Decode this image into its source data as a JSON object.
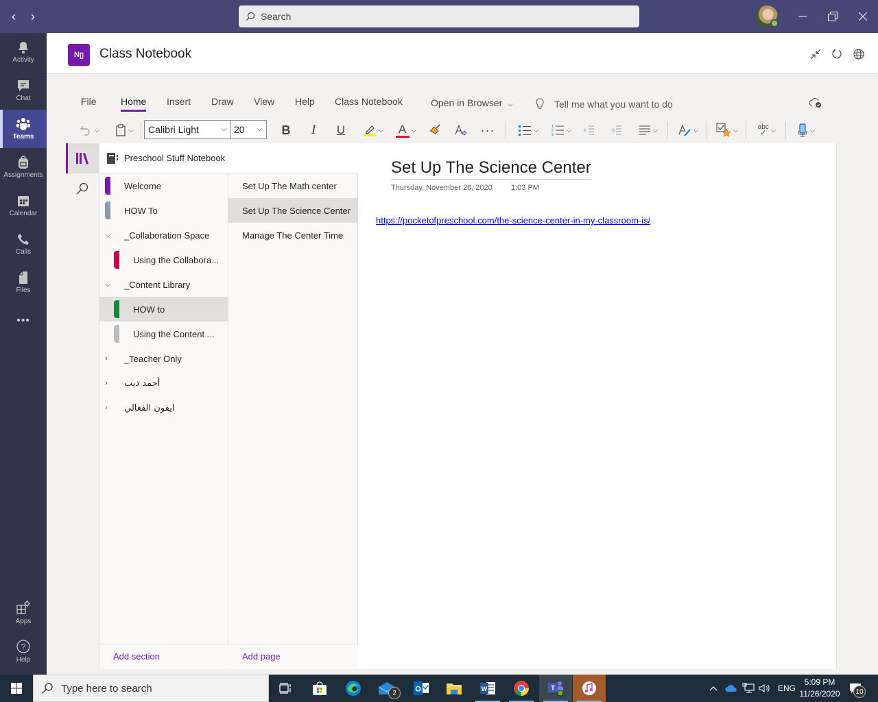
{
  "titlebar": {
    "back_label": "‹",
    "forward_label": "›",
    "search_placeholder": "Search",
    "minimize": "—",
    "restore": "❐",
    "close": "✕"
  },
  "rail": {
    "items": [
      {
        "label": "Activity",
        "icon": "bell-icon"
      },
      {
        "label": "Chat",
        "icon": "chat-icon"
      },
      {
        "label": "Teams",
        "icon": "teams-icon",
        "active": true
      },
      {
        "label": "Assignments",
        "icon": "backpack-icon"
      },
      {
        "label": "Calendar",
        "icon": "calendar-icon"
      },
      {
        "label": "Calls",
        "icon": "phone-icon"
      },
      {
        "label": "Files",
        "icon": "file-icon"
      },
      {
        "label": "•••",
        "icon": "more-icon"
      }
    ],
    "bottom": [
      {
        "label": "Apps",
        "icon": "apps-icon"
      },
      {
        "label": "Help",
        "icon": "help-icon"
      }
    ]
  },
  "app": {
    "title": "Class Notebook",
    "logo_text": "N"
  },
  "ribbon": {
    "tabs": [
      "File",
      "Home",
      "Insert",
      "Draw",
      "View",
      "Help",
      "Class Notebook"
    ],
    "active_tab": "Home",
    "open_in_browser": "Open in Browser",
    "tell_me": "Tell me what you want to do",
    "font_name": "Calibri Light",
    "font_size": "20",
    "bold": "B",
    "italic": "I",
    "underline": "U",
    "font_color_letter": "A",
    "highlight_color": "#ffff00",
    "font_color": "#e81123",
    "more": "···",
    "spelling_label": "abc"
  },
  "notebook": {
    "name": "Preschool Stuff Notebook",
    "sections": [
      {
        "label": "Welcome",
        "color": "#7719aa",
        "type": "section"
      },
      {
        "label": "HOW To",
        "color": "#8e9ba6",
        "type": "section"
      },
      {
        "label": "_Collaboration Space",
        "type": "group",
        "expanded": true
      },
      {
        "label": "Using the Collabora...",
        "color": "#c30052",
        "type": "child"
      },
      {
        "label": "_Content Library",
        "type": "group",
        "expanded": true
      },
      {
        "label": "HOW to",
        "color": "#10893e",
        "type": "child",
        "selected": true
      },
      {
        "label": "Using the Content ...",
        "color": "#bdbdbd",
        "type": "child"
      },
      {
        "label": "_Teacher Only",
        "type": "group",
        "expanded": false
      },
      {
        "label": "أحمد ديب",
        "type": "group",
        "expanded": false
      },
      {
        "label": "ايفون الفغالي",
        "type": "group",
        "expanded": false
      }
    ],
    "pages": [
      {
        "label": "Set Up The Math center"
      },
      {
        "label": "Set Up The Science Center",
        "selected": true
      },
      {
        "label": "Manage The Center Time"
      }
    ],
    "add_section": "Add section",
    "add_page": "Add page"
  },
  "page": {
    "title": "Set Up The Science Center",
    "date": "Thursday, November 26, 2020",
    "time": "1:03 PM",
    "link": "https://pocketofpreschool.com/the-science-center-in-my-classroom-is/"
  },
  "taskbar": {
    "search_placeholder": "Type here to search",
    "apps": [
      {
        "name": "task-view"
      },
      {
        "name": "microsoft-store"
      },
      {
        "name": "edge"
      },
      {
        "name": "mail",
        "badge": "2"
      },
      {
        "name": "outlook"
      },
      {
        "name": "file-explorer"
      },
      {
        "name": "word",
        "running": true
      },
      {
        "name": "chrome",
        "running": true
      },
      {
        "name": "teams",
        "running": true
      },
      {
        "name": "itunes",
        "running": true
      }
    ],
    "language": "ENG",
    "time": "5:09 PM",
    "date": "11/26/2020",
    "notifications": "10"
  }
}
